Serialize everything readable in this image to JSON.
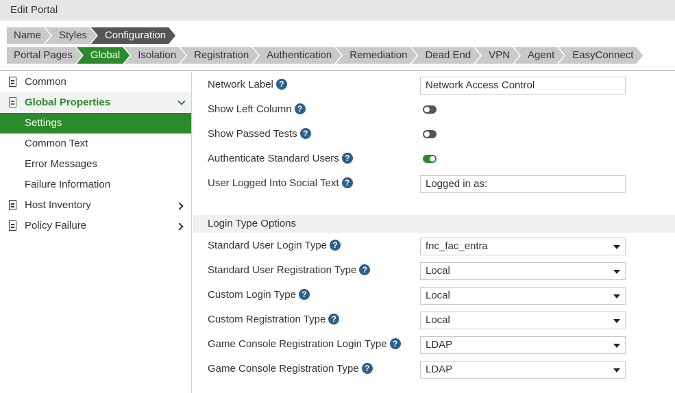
{
  "window": {
    "title": "Edit Portal"
  },
  "breadcrumbs_top": [
    "Name",
    "Styles",
    "Configuration"
  ],
  "breadcrumbs_tabs": [
    "Portal Pages",
    "Global",
    "Isolation",
    "Registration",
    "Authentication",
    "Remediation",
    "Dead End",
    "VPN",
    "Agent",
    "EasyConnect"
  ],
  "sidebar": {
    "items": [
      {
        "label": "Common"
      },
      {
        "label": "Global Properties"
      },
      {
        "label": "Settings"
      },
      {
        "label": "Common Text"
      },
      {
        "label": "Error Messages"
      },
      {
        "label": "Failure Information"
      },
      {
        "label": "Host Inventory"
      },
      {
        "label": "Policy Failure"
      }
    ]
  },
  "settings": {
    "network_label": {
      "label": "Network Label",
      "value": "Network Access Control"
    },
    "show_left_column": {
      "label": "Show Left Column",
      "enabled": false
    },
    "show_passed_tests": {
      "label": "Show Passed Tests",
      "enabled": false
    },
    "authenticate_standard_users": {
      "label": "Authenticate Standard Users",
      "enabled": true
    },
    "user_logged_into_social_text": {
      "label": "User Logged Into Social Text",
      "value": "Logged in as:"
    }
  },
  "login_type_options": {
    "header": "Login Type Options",
    "standard_user_login_type": {
      "label": "Standard User Login Type",
      "value": "fnc_fac_entra"
    },
    "standard_user_registration_type": {
      "label": "Standard User Registration Type",
      "value": "Local"
    },
    "custom_login_type": {
      "label": "Custom Login Type",
      "value": "Local"
    },
    "custom_registration_type": {
      "label": "Custom Registration Type",
      "value": "Local"
    },
    "game_console_registration_login_type": {
      "label": "Game Console Registration Login Type",
      "value": "LDAP"
    },
    "game_console_registration_type": {
      "label": "Game Console Registration Type",
      "value": "LDAP"
    }
  },
  "help_glyph": "?",
  "colors": {
    "accent_green": "#2b8a2b",
    "help_blue": "#2c5f8d",
    "crumb_dark": "#555555",
    "crumb_light": "#c9c9c9"
  }
}
